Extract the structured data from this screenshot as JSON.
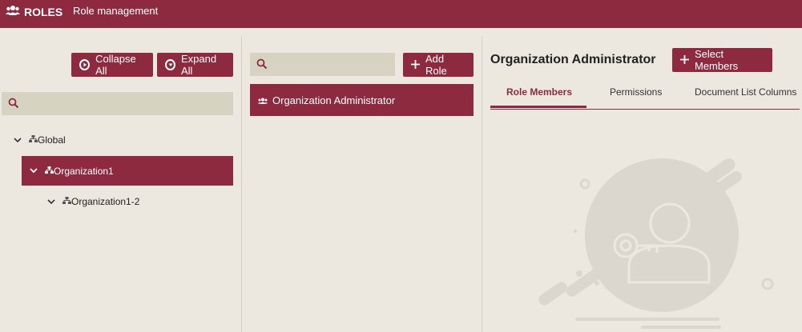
{
  "header": {
    "app_title": "ROLES",
    "subtitle": "Role management",
    "icon": "users-icon"
  },
  "left_panel": {
    "collapse_label": "Collapse All",
    "expand_label": "Expand All",
    "search_placeholder": "",
    "tree": [
      {
        "label": "Global",
        "selected": false
      },
      {
        "label": "Organization1",
        "selected": true
      },
      {
        "label": "Organization1-2",
        "selected": false
      }
    ]
  },
  "middle_panel": {
    "search_placeholder": "",
    "add_role_label": "Add Role",
    "roles": [
      {
        "label": "Organization Administrator",
        "selected": true
      }
    ]
  },
  "right_panel": {
    "title": "Organization Administrator",
    "select_members_label": "Select Members",
    "tabs": [
      {
        "label": "Role Members",
        "active": true
      },
      {
        "label": "Permissions",
        "active": false
      },
      {
        "label": "Document List Columns",
        "active": false
      }
    ],
    "empty_illustration": "role-members-empty-illustration"
  },
  "colors": {
    "accent": "#8e2a40",
    "background": "#ece8e0",
    "search_bg": "#d6d3c2"
  }
}
